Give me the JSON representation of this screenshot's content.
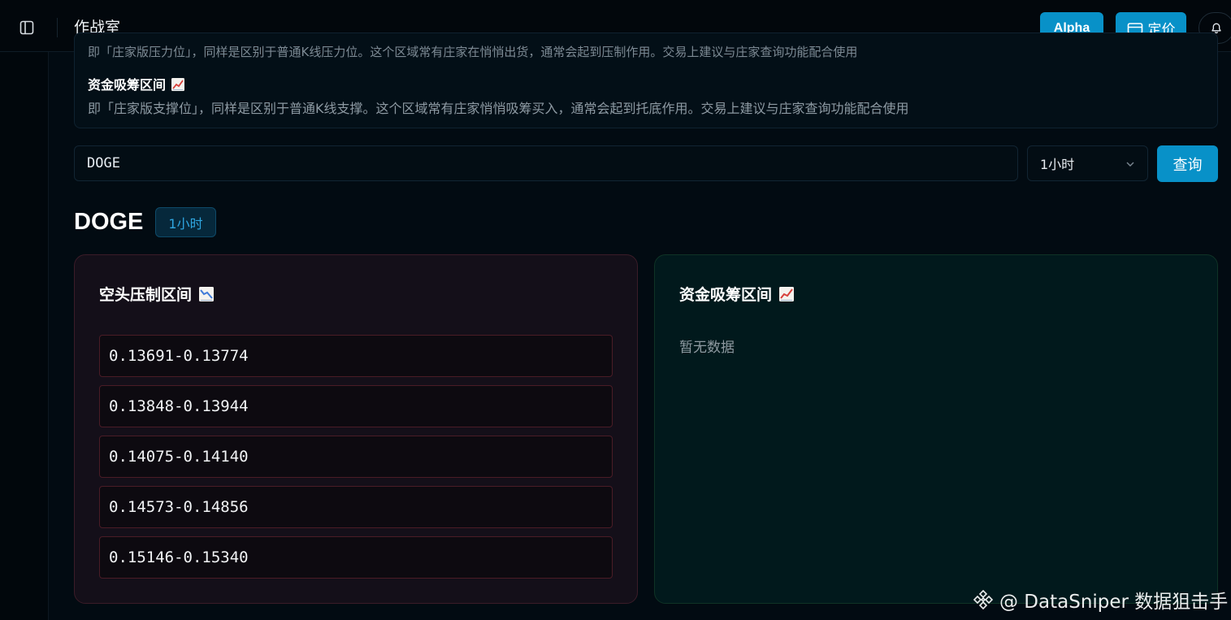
{
  "header": {
    "title": "作战室",
    "alpha_label": "Alpha",
    "pricing_label": "定价"
  },
  "info": {
    "prev_text": "即「庄家版压力位」，同样是区别于普通K线压力位。这个区域常有庄家在悄悄出货，通常会起到压制作用。交易上建议与庄家查询功能配合使用",
    "absorb_heading": "资金吸筹区间",
    "absorb_desc": "即「庄家版支撑位」，同样是区别于普通K线支撑。这个区域常有庄家悄悄吸筹买入，通常会起到托底作用。交易上建议与庄家查询功能配合使用"
  },
  "search": {
    "symbol_value": "DOGE",
    "interval_value": "1小时",
    "query_label": "查询"
  },
  "result": {
    "symbol": "DOGE",
    "interval": "1小时"
  },
  "bear_panel": {
    "title": "空头压制区间",
    "icon": "chart-decreasing-icon",
    "ranges": [
      "0.13691-0.13774",
      "0.13848-0.13944",
      "0.14075-0.14140",
      "0.14573-0.14856",
      "0.15146-0.15340"
    ]
  },
  "bull_panel": {
    "title": "资金吸筹区间",
    "icon": "chart-increasing-icon",
    "empty_text": "暂无数据"
  },
  "watermark": {
    "text": "@ DataSniper 数据狙击手"
  },
  "colors": {
    "accent": "#0891c8",
    "background": "#020b12",
    "bear_border": "#4a1c26",
    "bull_bg": "#01191c"
  }
}
